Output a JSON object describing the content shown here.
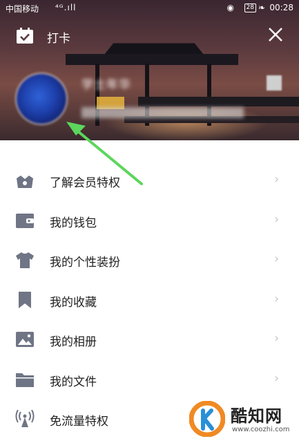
{
  "status_bar": {
    "carrier": "中国移动",
    "signal": "⁴ᴳ.ıll",
    "battery": "28",
    "time": "00:28"
  },
  "header": {
    "title": "打卡",
    "nickname": "学士年华",
    "signature": "............................"
  },
  "menu": {
    "items": [
      {
        "label": "了解会员特权",
        "icon": "vip-crown-icon"
      },
      {
        "label": "我的钱包",
        "icon": "wallet-icon"
      },
      {
        "label": "我的个性装扮",
        "icon": "shirt-icon"
      },
      {
        "label": "我的收藏",
        "icon": "bookmark-icon"
      },
      {
        "label": "我的相册",
        "icon": "photo-icon"
      },
      {
        "label": "我的文件",
        "icon": "folder-icon"
      },
      {
        "label": "免流量特权",
        "icon": "signal-tower-icon"
      }
    ],
    "chevron": "›"
  },
  "watermark": {
    "name": "酷知网",
    "url": "www.coozhi.com"
  },
  "colors": {
    "icon_gray": "#6f7585",
    "arrow_green": "#5cd65c",
    "logo_orange": "#f08a24",
    "logo_blue": "#2a8fd6"
  }
}
